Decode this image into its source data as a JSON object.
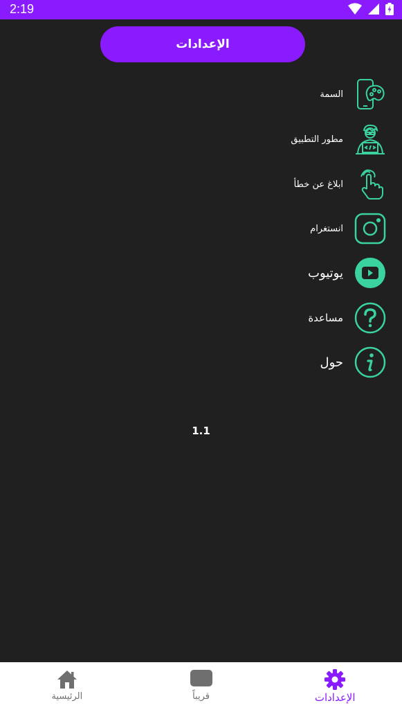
{
  "status_bar": {
    "time": "2:19",
    "icons": [
      "wifi-icon",
      "cellular-icon",
      "battery-icon"
    ]
  },
  "header": {
    "title": "الإعدادات"
  },
  "menu": {
    "items": [
      {
        "label": "السمة",
        "icon": "palette-phone-icon"
      },
      {
        "label": "مطور التطبيق",
        "icon": "developer-icon"
      },
      {
        "label": "ابلاغ عن خطأ",
        "icon": "touch-hand-icon"
      },
      {
        "label": "انستغرام",
        "icon": "instagram-icon"
      },
      {
        "label": "يوتيوب",
        "icon": "youtube-icon"
      },
      {
        "label": "مساعدة",
        "icon": "help-icon"
      },
      {
        "label": "حول",
        "icon": "info-icon"
      }
    ]
  },
  "version": "1.1",
  "bottom_nav": {
    "tabs": [
      {
        "label": "الرئيسية",
        "icon": "home-icon",
        "active": false
      },
      {
        "label": "قريباً",
        "icon": "soon-icon",
        "active": false
      },
      {
        "label": "الإعدادات",
        "icon": "settings-gear-icon",
        "active": true
      }
    ]
  },
  "colors": {
    "accent": "#8a1bff",
    "background": "#202020",
    "icon_green": "#3ad29f",
    "nav_background": "#ffffff",
    "nav_inactive": "#6f6f6f"
  }
}
